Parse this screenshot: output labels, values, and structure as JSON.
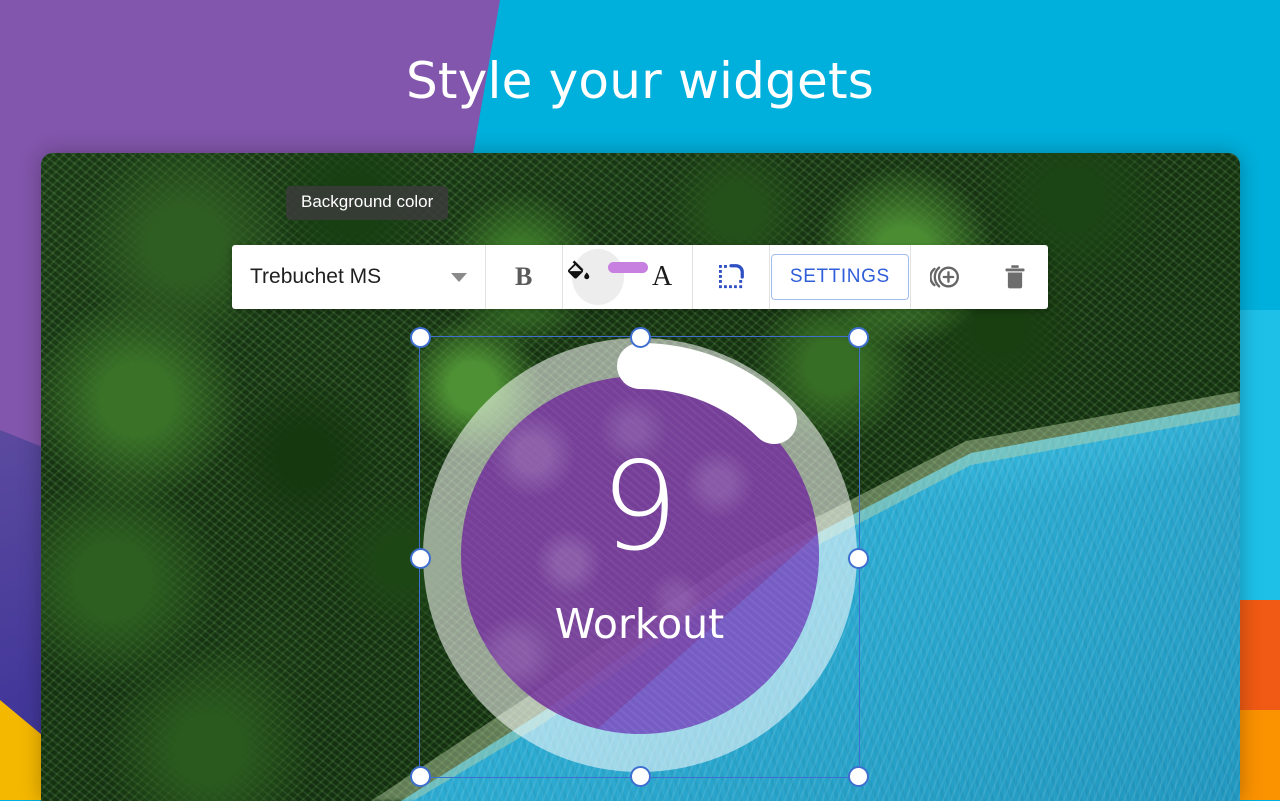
{
  "promo": {
    "title": "Style your widgets",
    "title_color": "#ffffff",
    "bg_purple": "#8256ac",
    "bg_cyan": "#00b0dc",
    "bg_orange": "#fb9200",
    "bg_orange_red": "#f05a14",
    "bg_yellow": "#f5b800"
  },
  "tooltip": {
    "text": "Background color"
  },
  "toolbar": {
    "font_name": "Trebuchet MS",
    "bold_label": "B",
    "text_color_label": "A",
    "settings_label": "SETTINGS",
    "background_swatch_color": "#c77fe0",
    "accent_color": "#2f5fd8",
    "icons": {
      "font_caret": "chevron-down-icon",
      "background_color": "paint-bucket-icon",
      "text_color": "text-color-icon",
      "corner_radius": "border-radius-icon",
      "duplicate": "add-circle-icon",
      "delete": "trash-icon"
    }
  },
  "widget": {
    "value": "9",
    "label": "Workout",
    "fill_color": "#6e249c",
    "ring_color": "#ffffff",
    "progress_arc_percent": 13
  },
  "selection": {
    "frame_color": "#3e6fd0",
    "handle_fill": "#ffffff",
    "handles": [
      "top-left",
      "top-center",
      "top-right",
      "middle-left",
      "middle-right",
      "bottom-left",
      "bottom-center",
      "bottom-right"
    ]
  }
}
